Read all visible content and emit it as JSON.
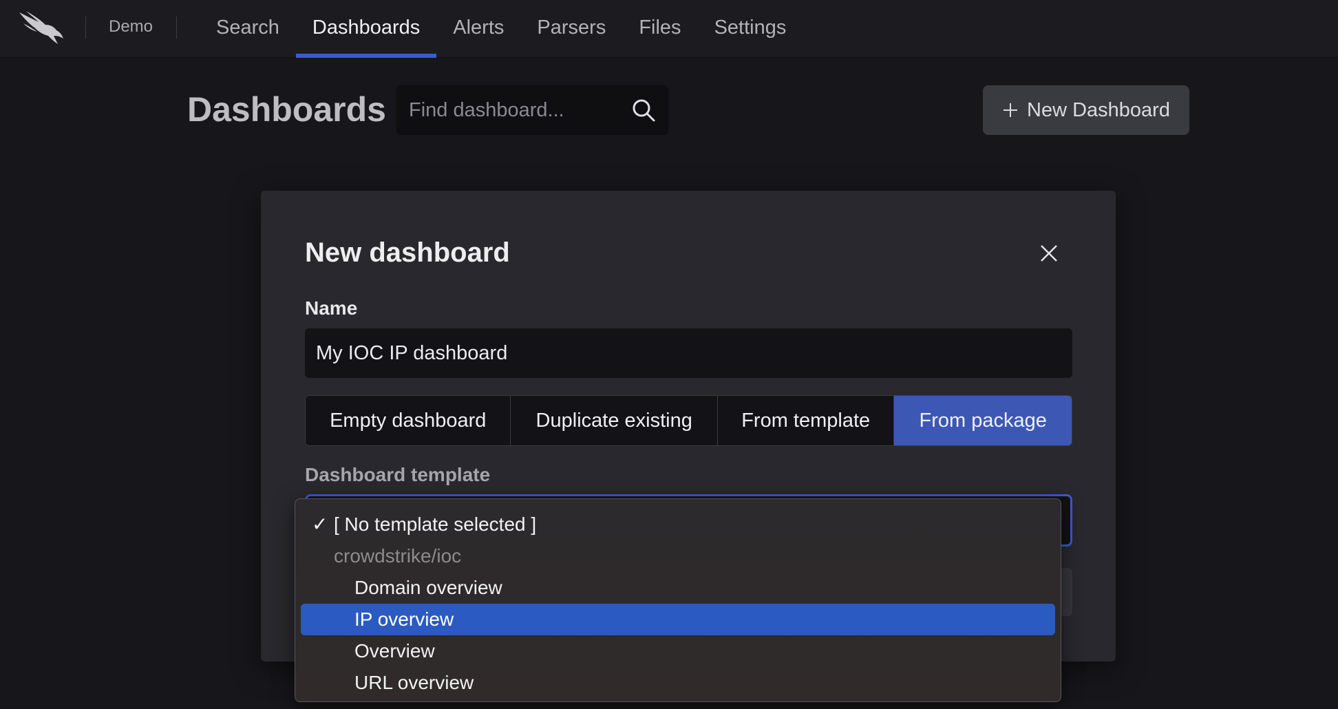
{
  "workspace": "Demo",
  "nav": {
    "items": [
      {
        "label": "Search",
        "active": false
      },
      {
        "label": "Dashboards",
        "active": true
      },
      {
        "label": "Alerts",
        "active": false
      },
      {
        "label": "Parsers",
        "active": false
      },
      {
        "label": "Files",
        "active": false
      },
      {
        "label": "Settings",
        "active": false
      }
    ]
  },
  "page": {
    "title": "Dashboards",
    "search_placeholder": "Find dashboard...",
    "new_button_label": "New Dashboard"
  },
  "modal": {
    "title": "New dashboard",
    "name_label": "Name",
    "name_value": "My IOC IP dashboard",
    "modes": [
      {
        "label": "Empty dashboard",
        "active": false
      },
      {
        "label": "Duplicate existing",
        "active": false
      },
      {
        "label": "From template",
        "active": false
      },
      {
        "label": "From package",
        "active": true
      }
    ],
    "template_label": "Dashboard template"
  },
  "dropdown": {
    "check_glyph": "✓",
    "options": [
      {
        "label": "[ No template selected ]",
        "checked": true
      },
      {
        "label": "crowdstrike/ioc",
        "group_header": true
      },
      {
        "label": "Domain overview"
      },
      {
        "label": "IP overview",
        "highlighted": true
      },
      {
        "label": "Overview"
      },
      {
        "label": "URL overview"
      }
    ]
  },
  "colors": {
    "accent": "#3a5bd1",
    "segment_active": "#3c58b4",
    "highlight": "#2b5bc2"
  }
}
